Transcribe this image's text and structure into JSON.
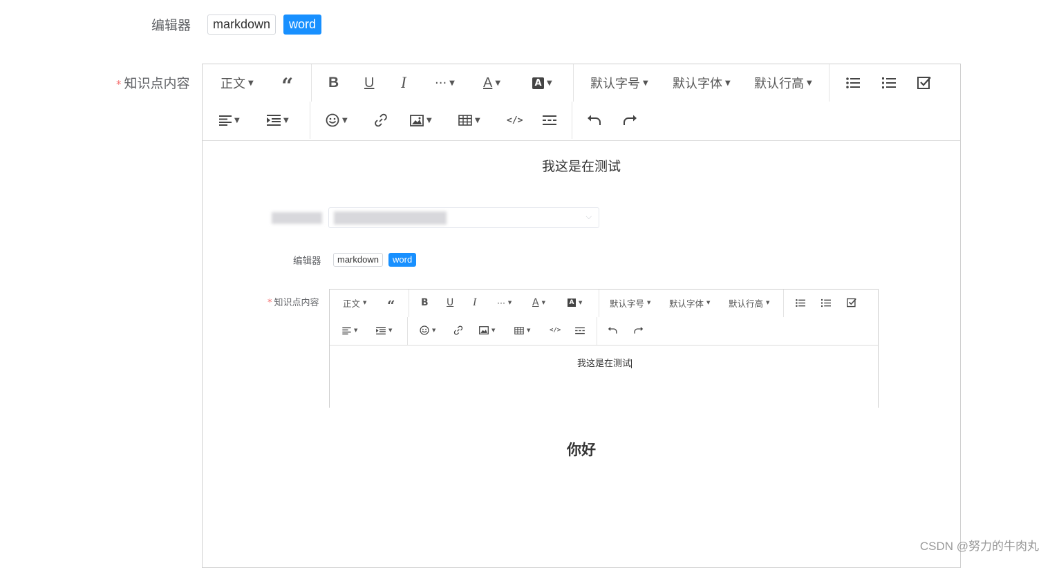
{
  "form": {
    "editor_label": "编辑器",
    "mode_tags": [
      "markdown",
      "word"
    ],
    "content_label": "知识点内容",
    "required_mark": "*"
  },
  "toolbar": {
    "paragraph": "正文",
    "font_size": "默认字号",
    "font_family": "默认字体",
    "line_height": "默认行高",
    "more": "···"
  },
  "editor": {
    "first_line": "我这是在测试",
    "heading_line": "你好"
  },
  "nested": {
    "editor_label": "编辑器",
    "mode_tags": [
      "markdown",
      "word"
    ],
    "content_label": "知识点内容",
    "required_mark": "*",
    "text": "我这是在测试"
  },
  "watermark": "CSDN @努力的牛肉丸",
  "colors": {
    "accent": "#1890ff",
    "required": "#f56c6c",
    "border": "#cfcfcf"
  }
}
